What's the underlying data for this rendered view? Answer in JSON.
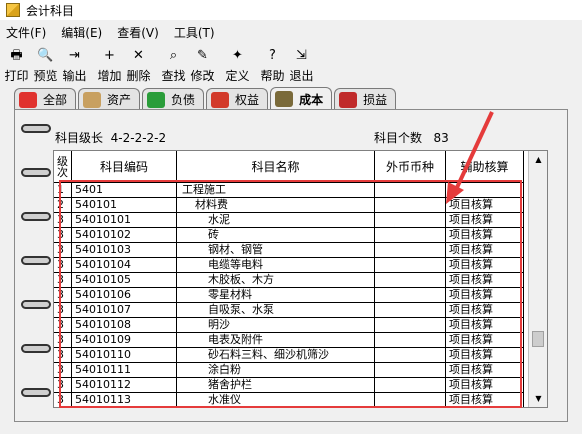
{
  "window": {
    "title": "会计科目"
  },
  "menu": [
    "文件(F)",
    "编辑(E)",
    "查看(V)",
    "工具(T)"
  ],
  "toolbar": [
    {
      "label": "打印",
      "icon": "printer-icon",
      "glyph": "🖶"
    },
    {
      "label": "预览",
      "icon": "preview-icon",
      "glyph": "🔍"
    },
    {
      "label": "输出",
      "icon": "export-icon",
      "glyph": "⇥"
    },
    {
      "label": "增加",
      "icon": "add-icon",
      "glyph": "+"
    },
    {
      "label": "删除",
      "icon": "delete-icon",
      "glyph": "✕"
    },
    {
      "label": "查找",
      "icon": "find-icon",
      "glyph": "⌕"
    },
    {
      "label": "修改",
      "icon": "edit-icon",
      "glyph": "✎"
    },
    {
      "label": "定义",
      "icon": "wand-icon",
      "glyph": "✦"
    },
    {
      "label": "帮助",
      "icon": "help-icon",
      "glyph": "?"
    },
    {
      "label": "退出",
      "icon": "exit-icon",
      "glyph": "⇲"
    }
  ],
  "tabs": [
    {
      "label": "全部",
      "icon": "all-icon",
      "color": "#e0322e"
    },
    {
      "label": "资产",
      "icon": "asset-icon",
      "color": "#c8a060"
    },
    {
      "label": "负债",
      "icon": "liability-icon",
      "color": "#2a9d3a"
    },
    {
      "label": "权益",
      "icon": "equity-icon",
      "color": "#d23a2a"
    },
    {
      "label": "成本",
      "icon": "cost-icon",
      "color": "#7a6a3a"
    },
    {
      "label": "损益",
      "icon": "pl-icon",
      "color": "#c02a2a"
    }
  ],
  "active_tab": "成本",
  "info": {
    "level_label": "科目级长",
    "level_value": "4-2-2-2-2",
    "count_label": "科目个数",
    "count_value": "83"
  },
  "table": {
    "headers": {
      "level": [
        "级",
        "次"
      ],
      "code": "科目编码",
      "name": "科目名称",
      "currency": "外币币种",
      "aux": "辅助核算"
    },
    "rows": [
      {
        "level": "1",
        "code": "5401",
        "name": "工程施工",
        "indent": 0,
        "currency": "",
        "aux": ""
      },
      {
        "level": "2",
        "code": "540101",
        "name": "材料费",
        "indent": 1,
        "currency": "",
        "aux": "项目核算"
      },
      {
        "level": "3",
        "code": "54010101",
        "name": "水泥",
        "indent": 2,
        "currency": "",
        "aux": "项目核算"
      },
      {
        "level": "3",
        "code": "54010102",
        "name": "砖",
        "indent": 2,
        "currency": "",
        "aux": "项目核算"
      },
      {
        "level": "3",
        "code": "54010103",
        "name": "钢材、钢管",
        "indent": 2,
        "currency": "",
        "aux": "项目核算"
      },
      {
        "level": "3",
        "code": "54010104",
        "name": "电缆等电料",
        "indent": 2,
        "currency": "",
        "aux": "项目核算"
      },
      {
        "level": "3",
        "code": "54010105",
        "name": "木胶板、木方",
        "indent": 2,
        "currency": "",
        "aux": "项目核算"
      },
      {
        "level": "3",
        "code": "54010106",
        "name": "零星材料",
        "indent": 2,
        "currency": "",
        "aux": "项目核算"
      },
      {
        "level": "3",
        "code": "54010107",
        "name": "自吸泵、水泵",
        "indent": 2,
        "currency": "",
        "aux": "项目核算"
      },
      {
        "level": "3",
        "code": "54010108",
        "name": "明沙",
        "indent": 2,
        "currency": "",
        "aux": "项目核算"
      },
      {
        "level": "3",
        "code": "54010109",
        "name": "电表及附件",
        "indent": 2,
        "currency": "",
        "aux": "项目核算"
      },
      {
        "level": "3",
        "code": "54010110",
        "name": "砂石料三料、细沙机筛沙",
        "indent": 2,
        "currency": "",
        "aux": "项目核算"
      },
      {
        "level": "3",
        "code": "54010111",
        "name": "涂白粉",
        "indent": 2,
        "currency": "",
        "aux": "项目核算"
      },
      {
        "level": "3",
        "code": "54010112",
        "name": "猪舍护栏",
        "indent": 2,
        "currency": "",
        "aux": "项目核算"
      },
      {
        "level": "3",
        "code": "54010113",
        "name": "水准仪",
        "indent": 2,
        "currency": "",
        "aux": "项目核算"
      }
    ]
  },
  "scrollbar": {
    "up": "▲",
    "down": "▼"
  }
}
